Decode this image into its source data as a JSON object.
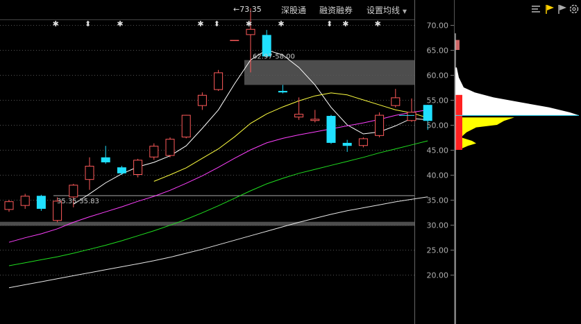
{
  "toolbar": {
    "btn_sgt": "深股通",
    "btn_rzrq": "融资融券",
    "btn_setma": "设置均线"
  },
  "icons": [
    "list-icon",
    "flag-yellow-icon",
    "flag-gray-icon",
    "settings-icon"
  ],
  "colors": {
    "up": "#ff5a5a",
    "down": "#20e0ff",
    "ma5": "#ffffff",
    "ma10": "#ffff40",
    "ma20": "#ff40ff",
    "ma30": "#20e020",
    "ma60": "#e8e8e8",
    "grid": "#555555",
    "zone": "#5a5a5a"
  },
  "chart_data": {
    "type": "candlestick",
    "ylim": [
      17.5,
      77.5
    ],
    "yticks": [
      "70.00",
      "65.00",
      "60.00",
      "55.00",
      "50.00",
      "45.00",
      "40.00",
      "35.00",
      "30.00",
      "25.00",
      "20.00"
    ],
    "candles": [
      {
        "o": 33.0,
        "h": 35.0,
        "l": 32.6,
        "c": 34.7
      },
      {
        "o": 33.8,
        "h": 36.2,
        "l": 33.2,
        "c": 35.8
      },
      {
        "o": 35.8,
        "h": 36.0,
        "l": 32.8,
        "c": 33.2
      },
      {
        "o": 30.8,
        "h": 35.5,
        "l": 30.5,
        "c": 34.8
      },
      {
        "o": 35.5,
        "h": 38.2,
        "l": 33.5,
        "c": 38.0
      },
      {
        "o": 39.0,
        "h": 43.5,
        "l": 37.0,
        "c": 41.8
      },
      {
        "o": 43.5,
        "h": 45.8,
        "l": 42.2,
        "c": 42.5
      },
      {
        "o": 41.5,
        "h": 41.8,
        "l": 40.0,
        "c": 40.3
      },
      {
        "o": 40.0,
        "h": 43.2,
        "l": 39.5,
        "c": 43.0
      },
      {
        "o": 43.5,
        "h": 46.3,
        "l": 43.0,
        "c": 45.8
      },
      {
        "o": 43.8,
        "h": 47.5,
        "l": 43.5,
        "c": 47.2
      },
      {
        "o": 47.5,
        "h": 52.0,
        "l": 47.3,
        "c": 52.0
      },
      {
        "o": 53.8,
        "h": 56.5,
        "l": 53.0,
        "c": 56.0
      },
      {
        "o": 57.0,
        "h": 61.0,
        "l": 56.8,
        "c": 60.5
      },
      {
        "o": 67.0,
        "h": 67.0,
        "l": 67.0,
        "c": 67.0
      },
      {
        "o": 68.0,
        "h": 73.35,
        "l": 60.5,
        "c": 69.2
      },
      {
        "o": 68.0,
        "h": 69.0,
        "l": 63.5,
        "c": 63.7
      },
      {
        "o": 56.8,
        "h": 58.0,
        "l": 56.3,
        "c": 56.5
      },
      {
        "o": 51.5,
        "h": 55.5,
        "l": 51.0,
        "c": 52.2
      },
      {
        "o": 50.8,
        "h": 53.0,
        "l": 50.5,
        "c": 51.2
      },
      {
        "o": 51.8,
        "h": 52.0,
        "l": 46.2,
        "c": 46.4
      },
      {
        "o": 46.4,
        "h": 47.0,
        "l": 44.6,
        "c": 45.8
      },
      {
        "o": 45.8,
        "h": 47.5,
        "l": 45.5,
        "c": 47.3
      },
      {
        "o": 47.8,
        "h": 52.5,
        "l": 47.5,
        "c": 52.0
      },
      {
        "o": 53.8,
        "h": 57.2,
        "l": 53.5,
        "c": 55.5
      },
      {
        "o": 50.8,
        "h": 55.3,
        "l": 50.6,
        "c": 52.6
      },
      {
        "o": 54.0,
        "h": 54.0,
        "l": 49.0,
        "c": 50.8
      }
    ],
    "ma_series": [
      {
        "color": "#ffffff",
        "values": [
          null,
          null,
          null,
          null,
          34.1,
          36.2,
          38.4,
          40.2,
          41.6,
          42.5,
          43.8,
          45.8,
          49.3,
          53.0,
          58.2,
          63.0,
          65.0,
          64.0,
          61.5,
          58.0,
          53.5,
          50.0,
          48.2,
          48.6,
          49.8,
          51.3,
          51.0
        ]
      },
      {
        "color": "#ffff40",
        "values": [
          null,
          null,
          null,
          null,
          null,
          null,
          null,
          null,
          null,
          38.7,
          40.0,
          41.4,
          43.3,
          45.2,
          47.6,
          50.3,
          52.2,
          53.6,
          54.8,
          55.8,
          56.4,
          56.0,
          55.0,
          54.0,
          53.0,
          52.4,
          51.4
        ]
      },
      {
        "color": "#ff40ff",
        "values": [
          26.5,
          27.4,
          28.2,
          29.2,
          30.5,
          31.6,
          32.6,
          33.6,
          34.7,
          35.7,
          36.9,
          38.3,
          39.8,
          41.5,
          43.3,
          45.0,
          46.4,
          47.3,
          48.0,
          48.6,
          49.2,
          49.8,
          50.4,
          51.1,
          51.9,
          52.5,
          53.0
        ]
      },
      {
        "color": "#20e020",
        "values": [
          21.8,
          22.4,
          23.0,
          23.6,
          24.3,
          25.1,
          25.9,
          26.8,
          27.8,
          28.8,
          29.9,
          31.1,
          32.4,
          33.8,
          35.3,
          36.8,
          38.2,
          39.3,
          40.3,
          41.1,
          41.9,
          42.7,
          43.5,
          44.4,
          45.2,
          46.0,
          46.8
        ]
      },
      {
        "color": "#e8e8e8",
        "values": [
          17.4,
          18.0,
          18.6,
          19.2,
          19.8,
          20.4,
          21.0,
          21.6,
          22.2,
          22.8,
          23.5,
          24.3,
          25.1,
          26.0,
          26.9,
          27.8,
          28.7,
          29.6,
          30.5,
          31.3,
          32.1,
          32.8,
          33.4,
          34.0,
          34.6,
          35.1,
          35.6
        ]
      }
    ],
    "zones": [
      {
        "low": 58.0,
        "high": 62.97,
        "label": "62.97-58.00"
      },
      {
        "low": 29.8,
        "high": 30.6,
        "label": ""
      }
    ],
    "ref_line": {
      "value": 35.83,
      "label": "35.35-35.83"
    },
    "high_label": "73.35",
    "markers": [
      "✱",
      "⬍",
      "✱",
      "✱",
      "⬍",
      "✱",
      "✱",
      "⬍",
      "✱",
      "✱"
    ],
    "marker_slots": [
      1,
      3,
      5,
      10,
      11,
      13,
      15,
      18,
      19,
      21
    ],
    "profile": {
      "cross_price": 51.9,
      "white": [
        [
          61.5,
          2
        ],
        [
          59.5,
          5
        ],
        [
          57.5,
          12
        ],
        [
          56.5,
          28
        ],
        [
          55.5,
          55
        ],
        [
          54.5,
          95
        ],
        [
          53.5,
          135
        ],
        [
          52.5,
          165
        ],
        [
          51.9,
          178
        ]
      ],
      "yellow": [
        [
          51.5,
          85
        ],
        [
          50.8,
          70
        ],
        [
          50.0,
          60
        ],
        [
          49.5,
          30
        ],
        [
          48.5,
          16
        ],
        [
          47.5,
          8
        ],
        [
          46.8,
          24
        ],
        [
          46.3,
          30
        ],
        [
          45.8,
          18
        ],
        [
          45.2,
          8
        ]
      ],
      "red_marks": [
        [
          66.5,
          4
        ],
        [
          66.0,
          6
        ],
        [
          65.5,
          5
        ]
      ]
    }
  }
}
